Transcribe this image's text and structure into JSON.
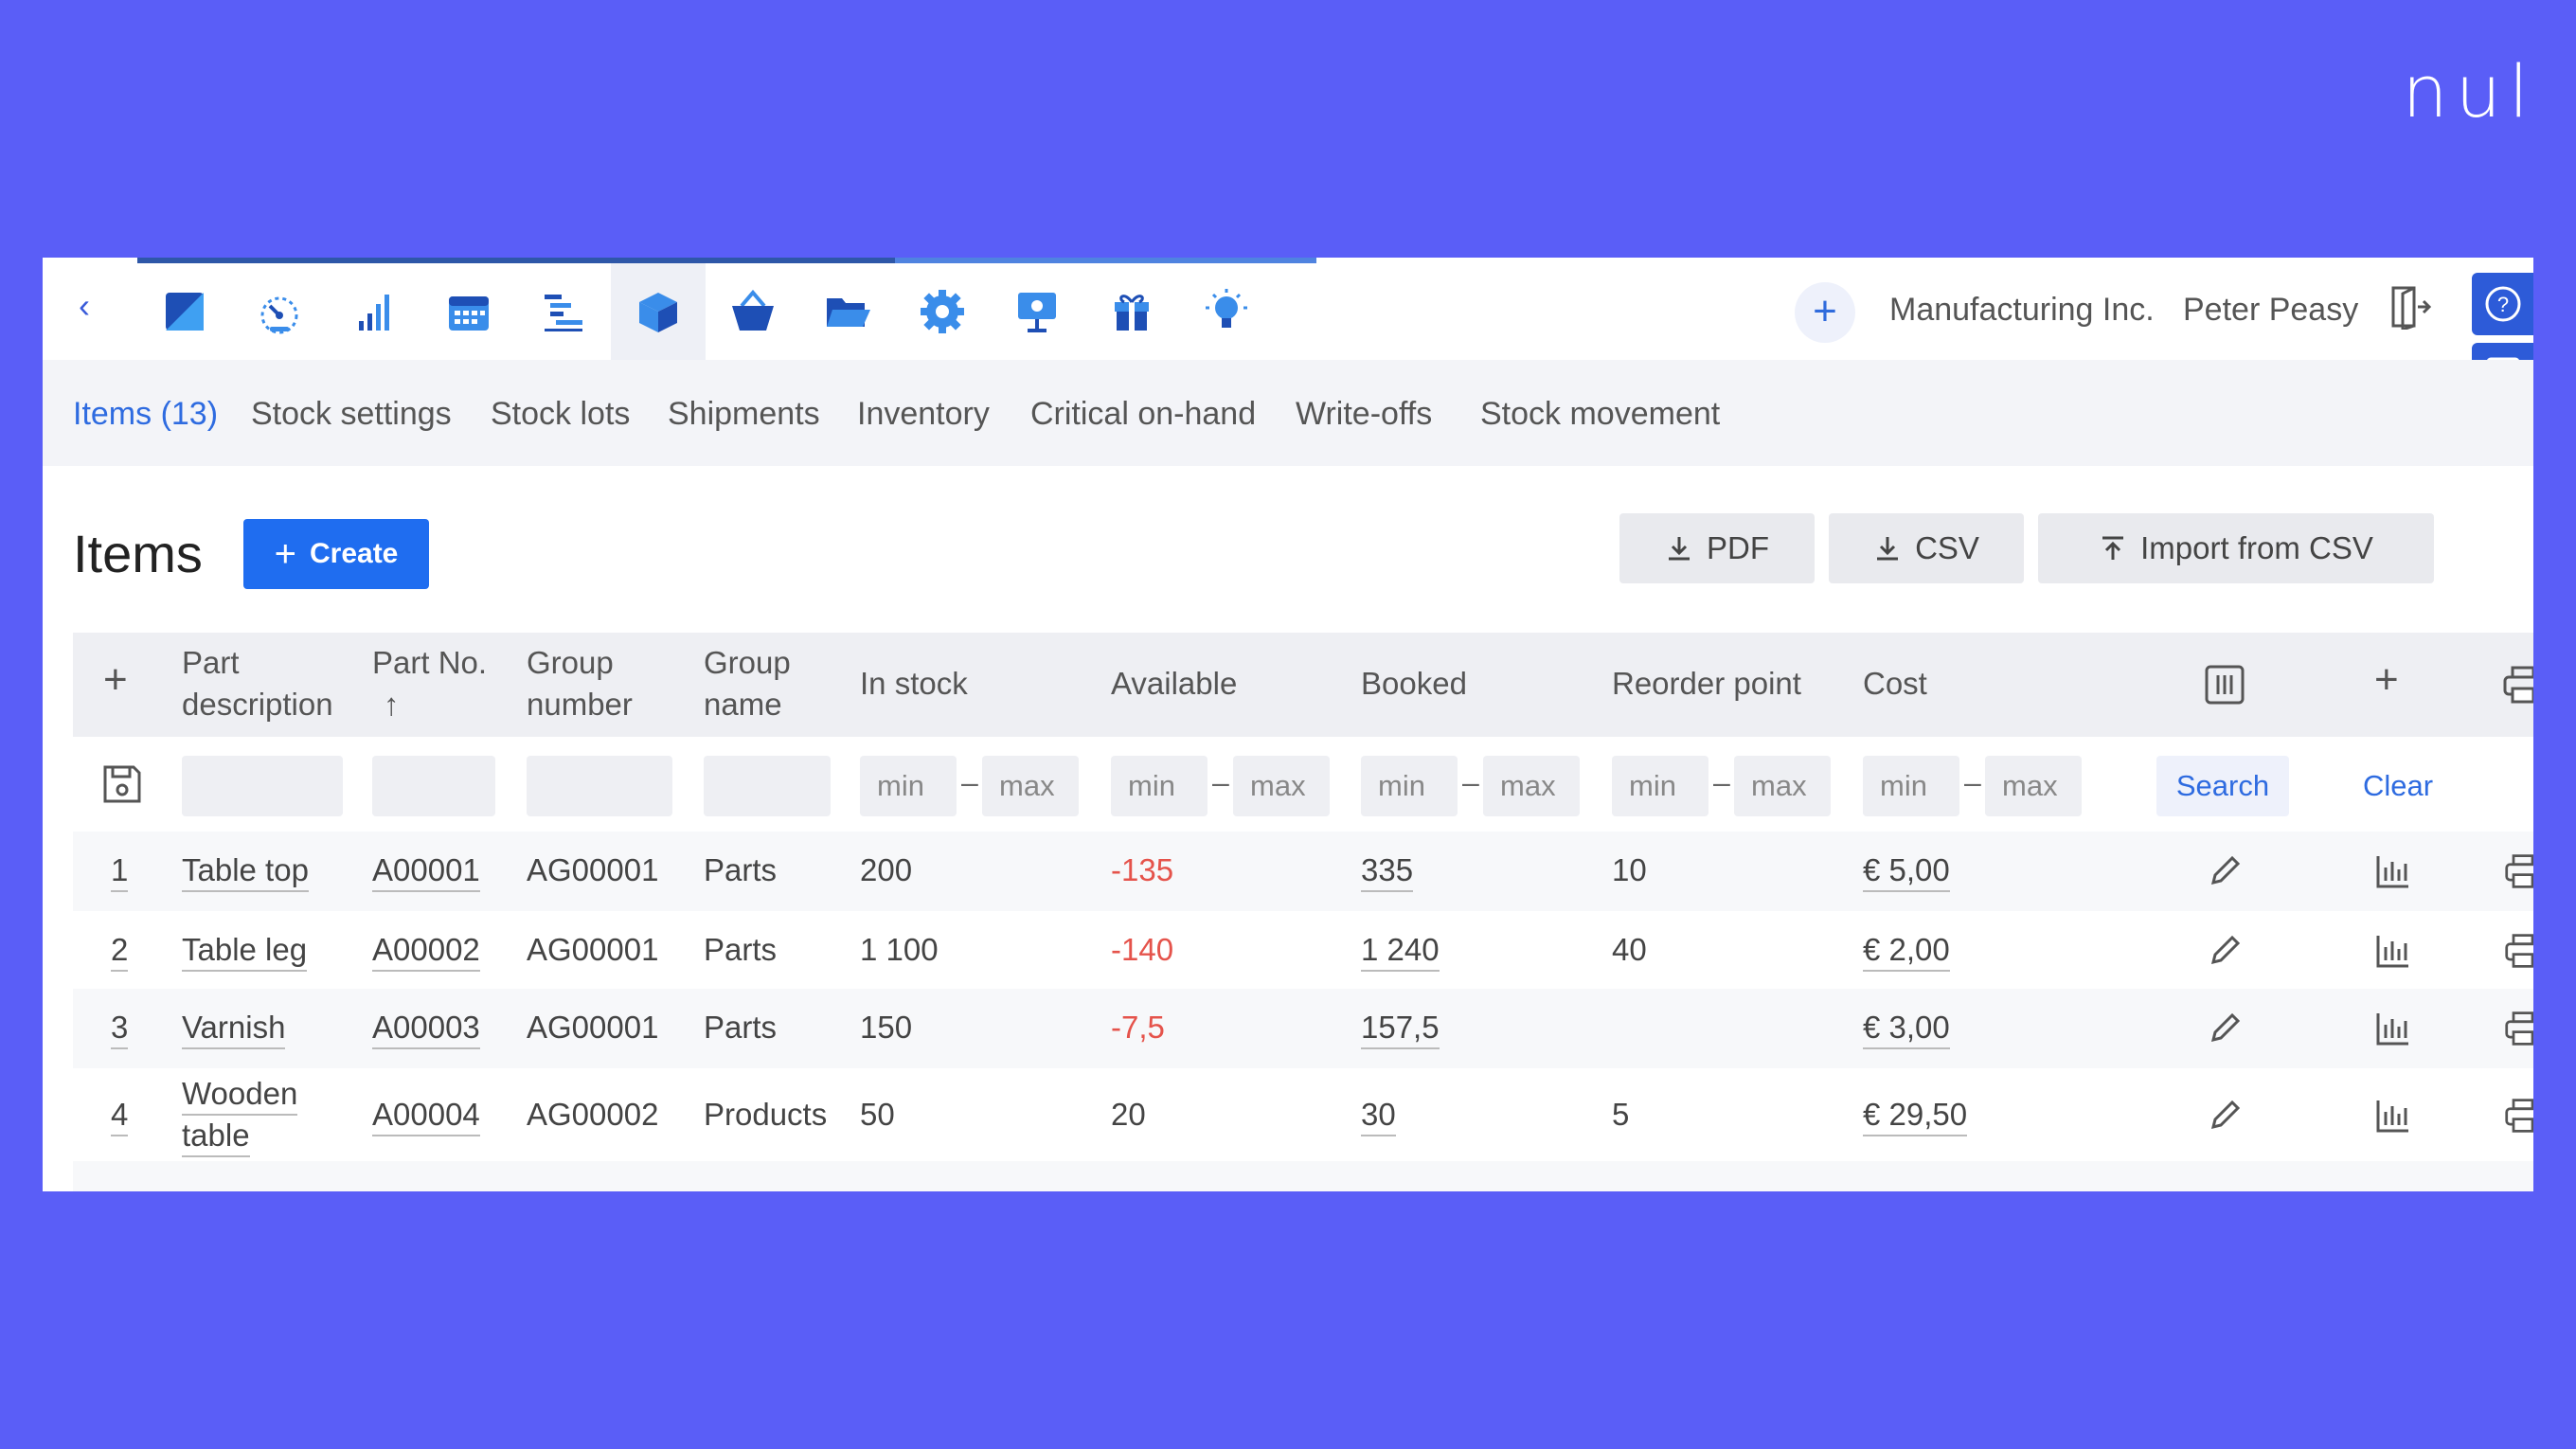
{
  "brand": "nul",
  "header": {
    "company": "Manufacturing Inc.",
    "user": "Peter Peasy",
    "nav_icons": [
      "dashboard-icon",
      "speedometer-icon",
      "bar-chart-icon",
      "calendar-icon",
      "gantt-icon",
      "box-icon",
      "basket-icon",
      "folder-icon",
      "gear-icon",
      "presentation-icon",
      "gift-icon",
      "lightbulb-icon"
    ]
  },
  "tabs": [
    "Items (13)",
    "Stock settings",
    "Stock lots",
    "Shipments",
    "Inventory",
    "Critical on-hand",
    "Write-offs",
    "Stock movement"
  ],
  "page": {
    "title": "Items",
    "create_label": "Create",
    "pdf_label": "PDF",
    "csv_label": "CSV",
    "import_label": "Import from CSV"
  },
  "table": {
    "headers": {
      "part_description": [
        "Part",
        "description"
      ],
      "part_no": "Part No.",
      "group_number": [
        "Group",
        "number"
      ],
      "group_name": [
        "Group",
        "name"
      ],
      "in_stock": "In stock",
      "available": "Available",
      "booked": "Booked",
      "reorder_point": "Reorder point",
      "cost": "Cost"
    },
    "filter": {
      "min_placeholder": "min",
      "max_placeholder": "max",
      "search_label": "Search",
      "clear_label": "Clear"
    },
    "rows": [
      {
        "num": "1",
        "desc": "Table top",
        "part_no": "A00001",
        "group_no": "AG00001",
        "group_name": "Parts",
        "in_stock": "200",
        "available": "-135",
        "booked": "335",
        "reorder": "10",
        "cost": "€ 5,00"
      },
      {
        "num": "2",
        "desc": "Table leg",
        "part_no": "A00002",
        "group_no": "AG00001",
        "group_name": "Parts",
        "in_stock": "1 100",
        "available": "-140",
        "booked": "1 240",
        "reorder": "40",
        "cost": "€ 2,00"
      },
      {
        "num": "3",
        "desc": "Varnish",
        "part_no": "A00003",
        "group_no": "AG00001",
        "group_name": "Parts",
        "in_stock": "150",
        "available": "-7,5",
        "booked": "157,5",
        "reorder": "",
        "cost": "€ 3,00"
      },
      {
        "num": "4",
        "desc_line1": "Wooden",
        "desc_line2": "table",
        "part_no": "A00004",
        "group_no": "AG00002",
        "group_name": "Products",
        "in_stock": "50",
        "available": "20",
        "booked": "30",
        "reorder": "5",
        "cost": "€ 29,50"
      }
    ]
  },
  "colors": {
    "background": "#5A5EF7",
    "accent": "#2E6BE0",
    "negative": "#E5534B"
  }
}
